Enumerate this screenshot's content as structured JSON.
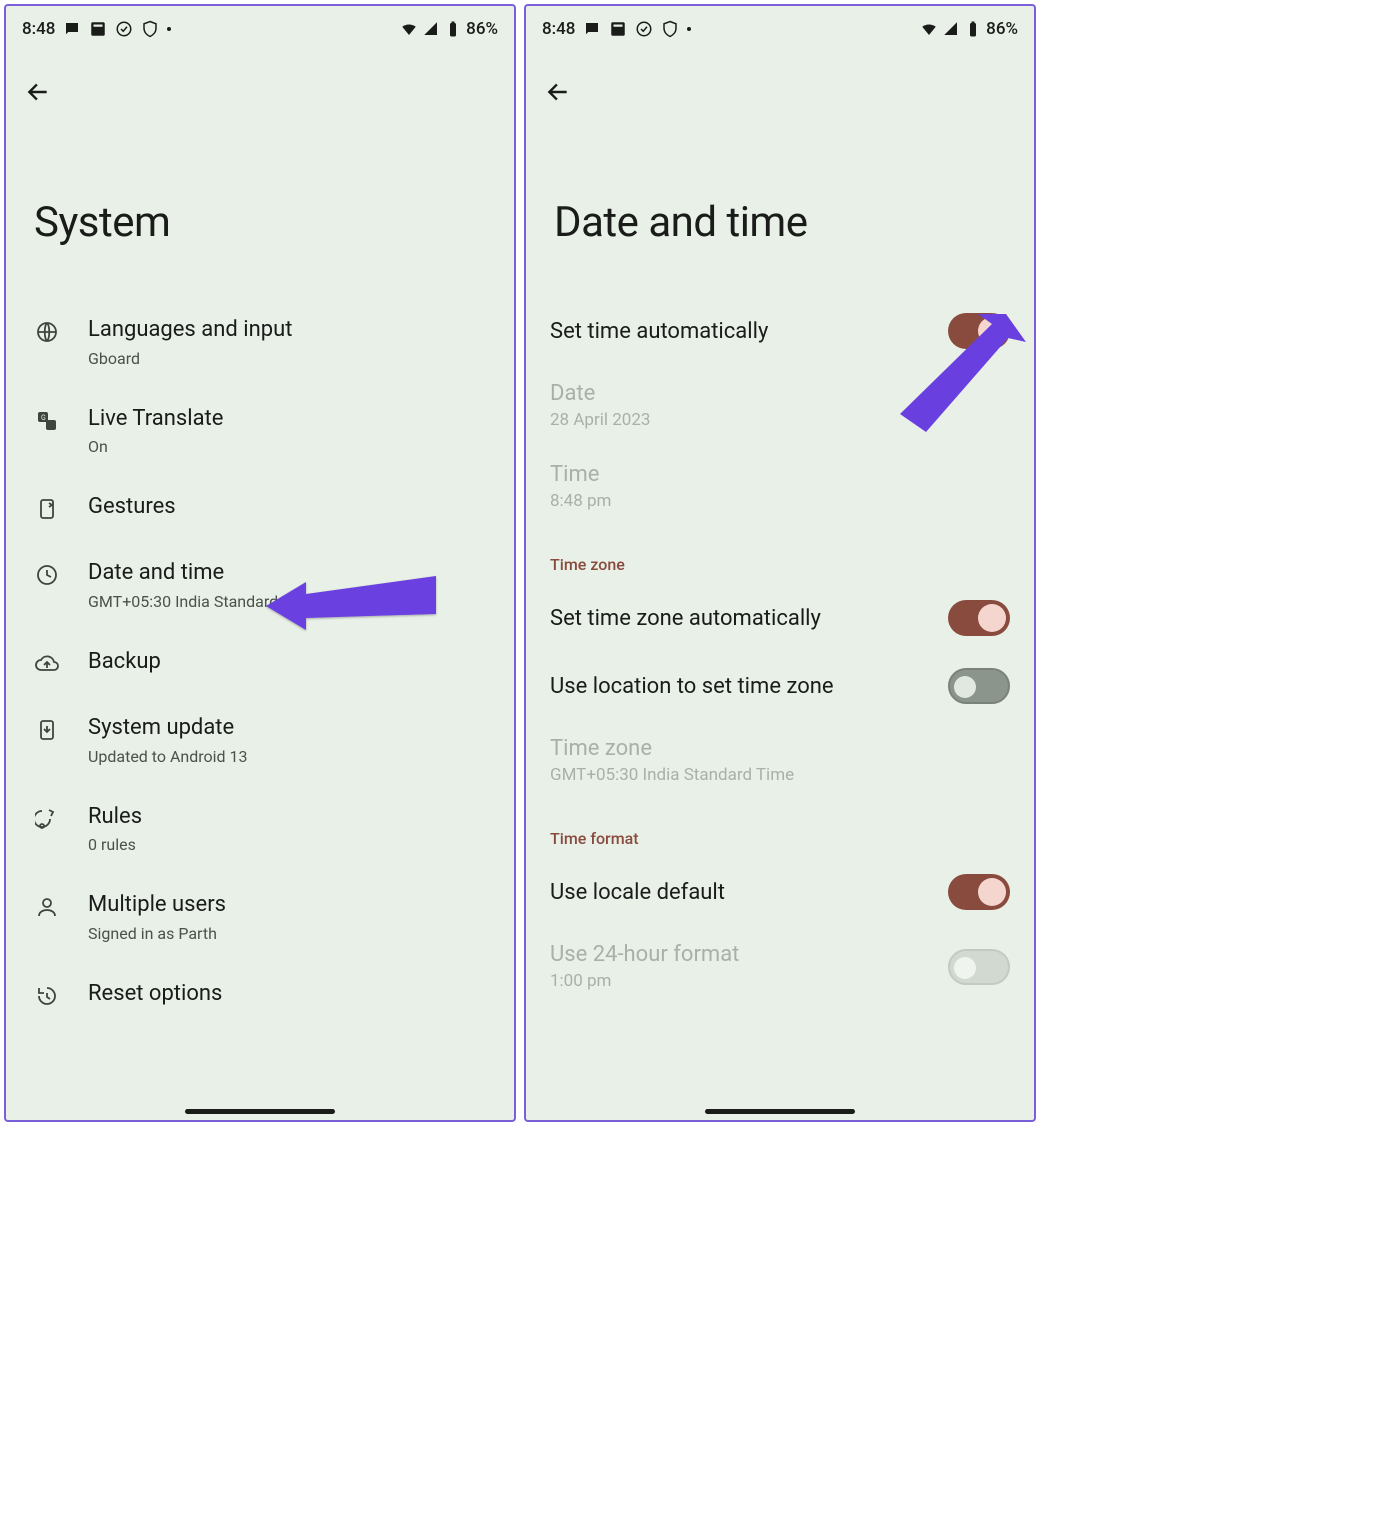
{
  "statusbar": {
    "time": "8:48",
    "battery": "86%"
  },
  "screen1": {
    "title": "System",
    "items": [
      {
        "id": "languages",
        "title": "Languages and input",
        "sub": "Gboard"
      },
      {
        "id": "live-translate",
        "title": "Live Translate",
        "sub": "On"
      },
      {
        "id": "gestures",
        "title": "Gestures",
        "sub": ""
      },
      {
        "id": "date-time",
        "title": "Date and time",
        "sub": "GMT+05:30 India Standard Time"
      },
      {
        "id": "backup",
        "title": "Backup",
        "sub": ""
      },
      {
        "id": "system-update",
        "title": "System update",
        "sub": "Updated to Android 13"
      },
      {
        "id": "rules",
        "title": "Rules",
        "sub": "0 rules"
      },
      {
        "id": "multiple-users",
        "title": "Multiple users",
        "sub": "Signed in as Parth"
      },
      {
        "id": "reset",
        "title": "Reset options",
        "sub": ""
      }
    ]
  },
  "screen2": {
    "title": "Date and time",
    "set_time_auto": {
      "label": "Set time automatically",
      "on": true
    },
    "date": {
      "label": "Date",
      "value": "28 April 2023"
    },
    "time": {
      "label": "Time",
      "value": "8:48 pm"
    },
    "section_tz": "Time zone",
    "set_tz_auto": {
      "label": "Set time zone automatically",
      "on": true
    },
    "use_location_tz": {
      "label": "Use location to set time zone",
      "on": false
    },
    "timezone": {
      "label": "Time zone",
      "value": "GMT+05:30 India Standard Time"
    },
    "section_format": "Time format",
    "use_locale_default": {
      "label": "Use locale default",
      "on": true
    },
    "use_24h": {
      "label": "Use 24-hour format",
      "value": "1:00 pm",
      "on": false
    }
  },
  "annotations": {
    "arrow_color": "#6a3fe0"
  }
}
